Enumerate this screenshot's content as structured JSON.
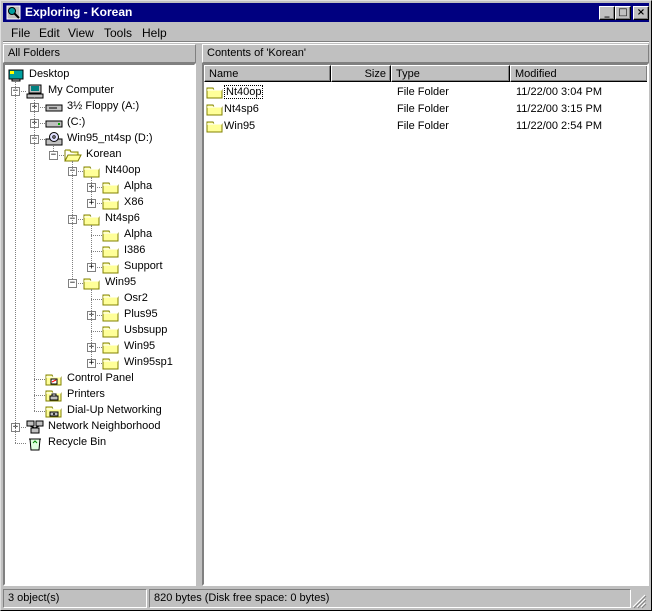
{
  "window": {
    "title": "Exploring - Korean",
    "min_glyph": "_",
    "max_glyph": "□",
    "close_glyph": "×"
  },
  "menu": [
    {
      "label": "File"
    },
    {
      "label": "Edit"
    },
    {
      "label": "View"
    },
    {
      "label": "Tools"
    },
    {
      "label": "Help"
    }
  ],
  "panes": {
    "left_header": "All Folders",
    "right_header": "Contents of 'Korean'"
  },
  "tree": [
    {
      "label": "Desktop",
      "icon": "desktop-icon"
    },
    {
      "label": "My Computer",
      "icon": "computer-icon",
      "expander": "−"
    },
    {
      "label": "3½ Floppy (A:)",
      "icon": "floppy-drive-icon",
      "expander": "+"
    },
    {
      "label": "(C:)",
      "icon": "hard-drive-icon",
      "expander": "+"
    },
    {
      "label": "Win95_nt4sp (D:)",
      "icon": "cdrom-drive-icon",
      "expander": "−"
    },
    {
      "label": "Korean",
      "icon": "open-folder-icon",
      "expander": "−"
    },
    {
      "label": "Nt40op",
      "icon": "folder-icon",
      "expander": "−"
    },
    {
      "label": "Alpha",
      "icon": "folder-icon",
      "expander": "+"
    },
    {
      "label": "X86",
      "icon": "folder-icon",
      "expander": "+"
    },
    {
      "label": "Nt4sp6",
      "icon": "folder-icon",
      "expander": "−"
    },
    {
      "label": "Alpha",
      "icon": "folder-icon"
    },
    {
      "label": "I386",
      "icon": "folder-icon"
    },
    {
      "label": "Support",
      "icon": "folder-icon",
      "expander": "+"
    },
    {
      "label": "Win95",
      "icon": "folder-icon",
      "expander": "−"
    },
    {
      "label": "Osr2",
      "icon": "folder-icon"
    },
    {
      "label": "Plus95",
      "icon": "folder-icon",
      "expander": "+"
    },
    {
      "label": "Usbsupp",
      "icon": "folder-icon"
    },
    {
      "label": "Win95",
      "icon": "folder-icon",
      "expander": "+"
    },
    {
      "label": "Win95sp1",
      "icon": "folder-icon",
      "expander": "+"
    },
    {
      "label": "Control Panel",
      "icon": "control-panel-icon"
    },
    {
      "label": "Printers",
      "icon": "printers-icon"
    },
    {
      "label": "Dial-Up Networking",
      "icon": "dialup-networking-icon"
    },
    {
      "label": "Network Neighborhood",
      "icon": "network-neighborhood-icon",
      "expander": "+"
    },
    {
      "label": "Recycle Bin",
      "icon": "recycle-bin-icon"
    }
  ],
  "columns": [
    {
      "label": "Name"
    },
    {
      "label": "Size"
    },
    {
      "label": "Type"
    },
    {
      "label": "Modified"
    }
  ],
  "files": [
    {
      "name": "Nt40op",
      "size": "",
      "type": "File Folder",
      "modified": "11/22/00 3:04 PM"
    },
    {
      "name": "Nt4sp6",
      "size": "",
      "type": "File Folder",
      "modified": "11/22/00 3:15 PM"
    },
    {
      "name": "Win95",
      "size": "",
      "type": "File Folder",
      "modified": "11/22/00 2:54 PM"
    }
  ],
  "status": {
    "count": "3 object(s)",
    "space": "820 bytes (Disk free space: 0 bytes)"
  },
  "colors": {
    "title_bar": "#000080",
    "face": "#c0c0c0",
    "folder": "#ffff99",
    "folder_dark": "#808000"
  }
}
